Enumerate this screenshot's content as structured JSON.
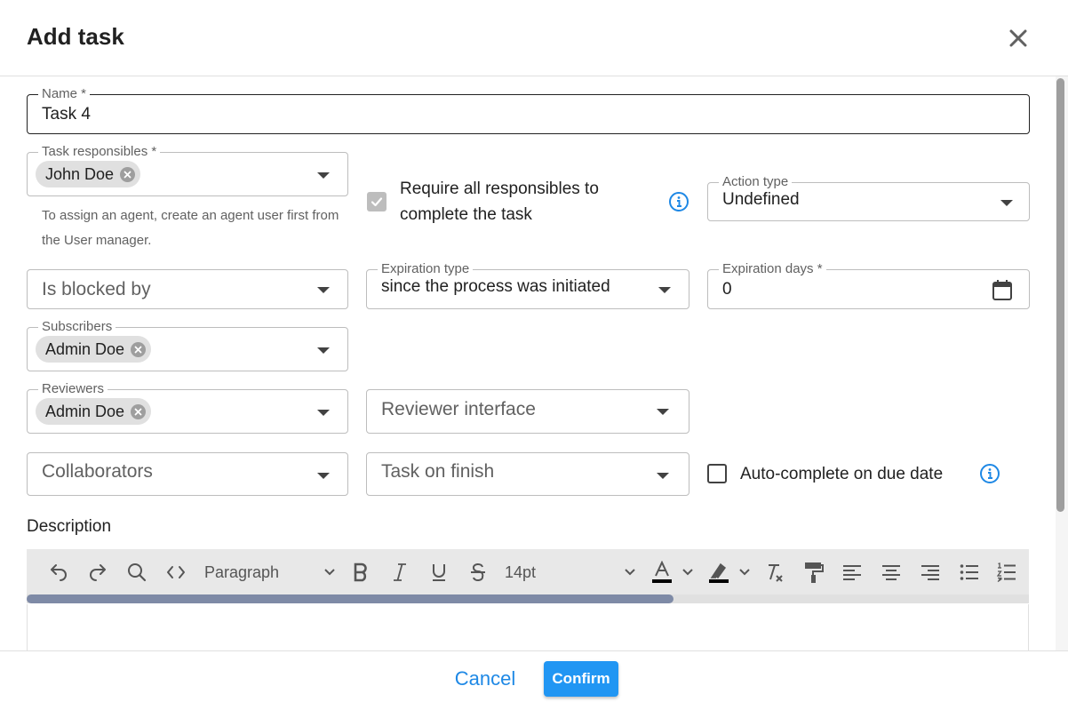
{
  "dialog": {
    "title": "Add task"
  },
  "fields": {
    "name": {
      "label": "Name *",
      "value": "Task 4"
    },
    "task_responsibles": {
      "label": "Task responsibles *",
      "chips": [
        "John Doe"
      ],
      "hint": "To assign an agent, create an agent user first from the User manager."
    },
    "require_all": {
      "label": "Require all responsibles to complete the task",
      "checked": true,
      "disabled": true
    },
    "action_type": {
      "label": "Action type",
      "value": "Undefined"
    },
    "is_blocked_by": {
      "placeholder": "Is blocked by"
    },
    "expiration_type": {
      "label": "Expiration type",
      "value": "since the process was initiated"
    },
    "expiration_days": {
      "label": "Expiration days *",
      "value": "0"
    },
    "subscribers": {
      "label": "Subscribers",
      "chips": [
        "Admin Doe"
      ]
    },
    "reviewers": {
      "label": "Reviewers",
      "chips": [
        "Admin Doe"
      ]
    },
    "reviewer_interface": {
      "placeholder": "Reviewer interface"
    },
    "collaborators": {
      "placeholder": "Collaborators"
    },
    "task_on_finish": {
      "placeholder": "Task on finish"
    },
    "auto_complete": {
      "label": "Auto-complete on due date",
      "checked": false
    }
  },
  "description": {
    "label": "Description",
    "toolbar": {
      "block_format": "Paragraph",
      "font_size": "14pt"
    }
  },
  "footer": {
    "cancel": "Cancel",
    "confirm": "Confirm"
  },
  "colors": {
    "primary": "#2196f3",
    "info": "#1e88e5",
    "toolbar_bg": "#e8e8e8"
  }
}
